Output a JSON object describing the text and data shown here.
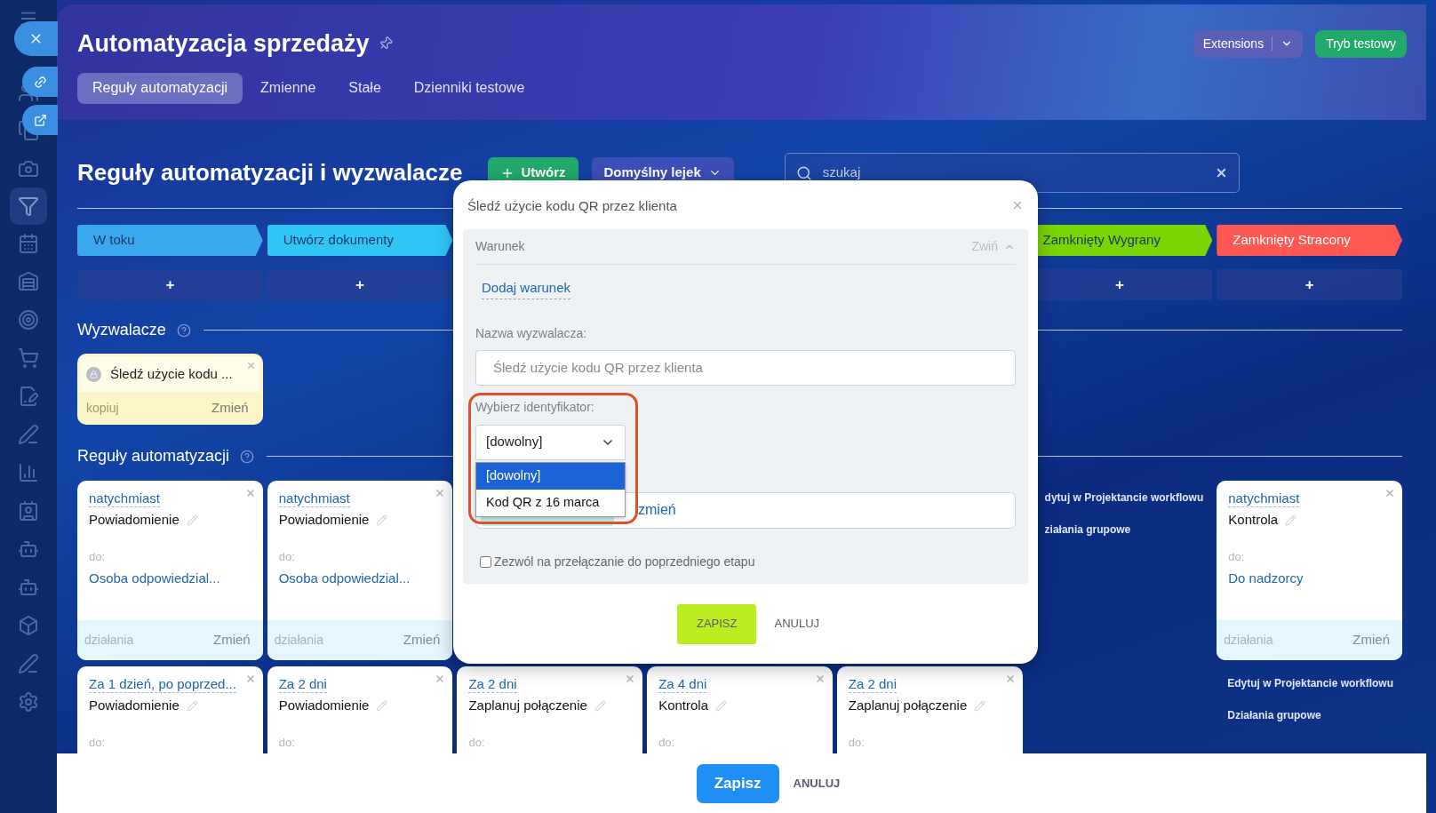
{
  "header": {
    "title": "Automatyzacja sprzedaży",
    "extensions_button": "Extensions",
    "test_mode_button": "Tryb testowy"
  },
  "tabs": [
    {
      "label": "Reguły automatyzacji",
      "selected": true
    },
    {
      "label": "Zmienne",
      "selected": false
    },
    {
      "label": "Stałe",
      "selected": false
    },
    {
      "label": "Dzienniki testowe",
      "selected": false
    }
  ],
  "toolbar": {
    "title": "Reguły automatyzacji i wyzwalacze",
    "create_button": "Utwórz",
    "funnel_button": "Domyślny lejek",
    "search": {
      "placeholder": "szukaj"
    }
  },
  "stages": [
    {
      "label": "W toku",
      "color": "#39a8ef",
      "add": "+"
    },
    {
      "label": "Utwórz dokumenty",
      "color": "#2fc6f6",
      "add": "+"
    },
    {
      "label": "Zamknięty Wygrany",
      "color": "#7bd500",
      "add": "+"
    },
    {
      "label": "Zamknięty Stracony",
      "color": "#ff5752",
      "add": "+"
    }
  ],
  "triggers_heading": "Wyzwalacze",
  "triggers": [
    {
      "title": "Śledź użycie kodu ...",
      "copy": "kopiuj",
      "edit": "Zmień"
    }
  ],
  "rules_heading": "Reguły automatyzacji",
  "rule_rows": [
    {
      "cells": [
        {
          "kind": "rule",
          "delay": "natychmiast",
          "action": "Powiadomienie",
          "to_label": "do:",
          "to": "Osoba odpowiedzial...",
          "actions_label": "działania",
          "edit": "Zmień"
        },
        {
          "kind": "rule",
          "delay": "natychmiast",
          "action": "Powiadomienie",
          "to_label": "do:",
          "to": "Osoba odpowiedzial...",
          "actions_label": "działania",
          "edit": "Zmień"
        },
        {
          "kind": "empty"
        },
        {
          "kind": "empty"
        },
        {
          "kind": "empty"
        },
        {
          "kind": "links",
          "items": [
            "dytuj w Projektancie workflowu",
            "ziałania grupowe"
          ]
        },
        {
          "kind": "rule",
          "delay": "natychmiast",
          "action": "Kontrola",
          "to_label": "do:",
          "to": "Do nadzorcy",
          "actions_label": "działania",
          "edit": "Zmień"
        }
      ]
    },
    {
      "cells": [
        {
          "kind": "rule",
          "delay": "Za 1 dzień, po poprzed...",
          "action": "Powiadomienie",
          "to_label": "do:"
        },
        {
          "kind": "rule",
          "delay": "Za 2 dni",
          "action": "Powiadomienie",
          "to_label": "do:"
        },
        {
          "kind": "rule",
          "delay": "Za 2 dni",
          "action": "Zaplanuj połączenie",
          "to_label": "do:"
        },
        {
          "kind": "rule",
          "delay": "Za 4 dni",
          "action": "Kontrola",
          "to_label": "do:"
        },
        {
          "kind": "rule",
          "delay": "Za 2 dni",
          "action": "Zaplanuj połączenie",
          "to_label": "do:"
        },
        {
          "kind": "empty"
        },
        {
          "kind": "links",
          "items": [
            "Edytuj w Projektancie workflowu",
            "Działania grupowe"
          ]
        }
      ]
    }
  ],
  "dialog": {
    "title": "Śledź użycie kodu QR przez klienta",
    "condition": {
      "title": "Warunek",
      "collapse": "Zwiń",
      "add": "Dodaj warunek"
    },
    "name_label": "Nazwa wyzwalacza:",
    "name_value": "Śledź użycie kodu QR przez klienta",
    "identifier": {
      "label": "Wybierz identyfikator:",
      "value": "[dowolny]",
      "expanded": true,
      "options": [
        {
          "label": "[dowolny]",
          "selected": true
        },
        {
          "label": "Kod QR z 16 marca",
          "selected": false
        }
      ]
    },
    "responsible": {
      "change": "zmień"
    },
    "allow_back": {
      "label": "Zezwól na przełączanie do poprzedniego etapu",
      "checked": false
    },
    "save": "ZAPISZ",
    "cancel": "ANULUJ"
  },
  "footer": {
    "save": "Zapisz",
    "cancel": "ANULUJ"
  }
}
